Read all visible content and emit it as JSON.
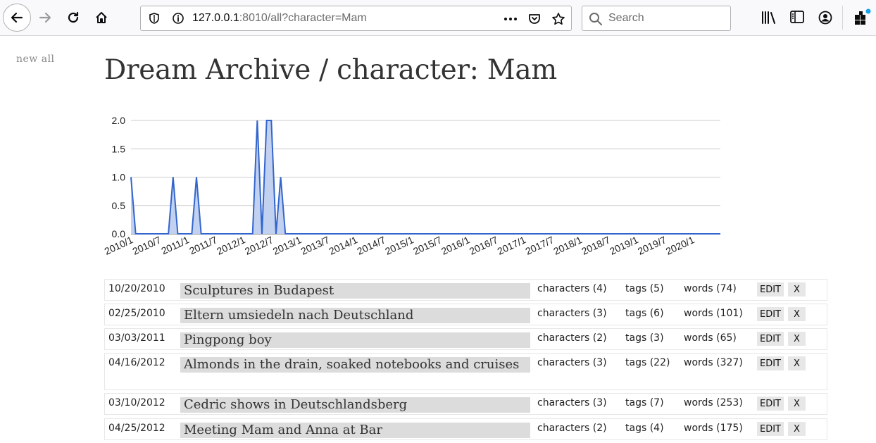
{
  "browser": {
    "url_host": "127.0.0.1",
    "url_rest": ":8010/all?character=Mam",
    "search_placeholder": "Search",
    "icons": [
      "back-arrow-icon",
      "forward-arrow-icon",
      "reload-icon",
      "home-icon",
      "shield-icon",
      "info-icon",
      "more-icon",
      "pocket-icon",
      "star-icon",
      "search-icon",
      "library-icon",
      "sidebar-icon",
      "account-icon",
      "extensions-icon"
    ]
  },
  "nav": {
    "new_all": "new all"
  },
  "page": {
    "title": "Dream Archive / character: Mam"
  },
  "chart_data": {
    "type": "area",
    "x": [
      "2010/1",
      "2010/2",
      "2010/3",
      "2010/4",
      "2010/5",
      "2010/6",
      "2010/7",
      "2010/8",
      "2010/9",
      "2010/10",
      "2010/11",
      "2010/12",
      "2011/1",
      "2011/2",
      "2011/3",
      "2011/4",
      "2011/5",
      "2011/6",
      "2011/7",
      "2011/8",
      "2011/9",
      "2011/10",
      "2011/11",
      "2011/12",
      "2012/1",
      "2012/2",
      "2012/3",
      "2012/4",
      "2012/5",
      "2012/6",
      "2012/7",
      "2012/8",
      "2012/9",
      "2012/10",
      "2012/11",
      "2012/12",
      "2013/1",
      "2013/2",
      "2013/3",
      "2013/4",
      "2013/5",
      "2013/6",
      "2013/7",
      "2013/8",
      "2013/9",
      "2013/10",
      "2013/11",
      "2013/12",
      "2014/1",
      "2014/2",
      "2014/3",
      "2014/4",
      "2014/5",
      "2014/6",
      "2014/7",
      "2014/8",
      "2014/9",
      "2014/10",
      "2014/11",
      "2014/12",
      "2015/1",
      "2015/2",
      "2015/3",
      "2015/4",
      "2015/5",
      "2015/6",
      "2015/7",
      "2015/8",
      "2015/9",
      "2015/10",
      "2015/11",
      "2015/12",
      "2016/1",
      "2016/2",
      "2016/3",
      "2016/4",
      "2016/5",
      "2016/6",
      "2016/7",
      "2016/8",
      "2016/9",
      "2016/10",
      "2016/11",
      "2016/12",
      "2017/1",
      "2017/2",
      "2017/3",
      "2017/4",
      "2017/5",
      "2017/6",
      "2017/7",
      "2017/8",
      "2017/9",
      "2017/10",
      "2017/11",
      "2017/12",
      "2018/1",
      "2018/2",
      "2018/3",
      "2018/4",
      "2018/5",
      "2018/6",
      "2018/7",
      "2018/8",
      "2018/9",
      "2018/10",
      "2018/11",
      "2018/12",
      "2019/1",
      "2019/2",
      "2019/3",
      "2019/4",
      "2019/5",
      "2019/6",
      "2019/7",
      "2019/8",
      "2019/9",
      "2019/10",
      "2019/11",
      "2019/12",
      "2020/1",
      "2020/2",
      "2020/3",
      "2020/4",
      "2020/5",
      "2020/6",
      "2020/7"
    ],
    "values": [
      1,
      0,
      0,
      0,
      0,
      0,
      0,
      0,
      0,
      1,
      0,
      0,
      0,
      0,
      1,
      0,
      0,
      0,
      0,
      0,
      0,
      0,
      0,
      0,
      0,
      0,
      0,
      2,
      0,
      2,
      2,
      0,
      1,
      0,
      0,
      0,
      0,
      0,
      0,
      0,
      0,
      0,
      0,
      0,
      0,
      0,
      0,
      0,
      0,
      0,
      0,
      0,
      0,
      0,
      0,
      0,
      0,
      0,
      0,
      0,
      0,
      0,
      0,
      0,
      0,
      0,
      0,
      0,
      0,
      0,
      0,
      0,
      0,
      0,
      0,
      0,
      0,
      0,
      0,
      0,
      0,
      0,
      0,
      0,
      0,
      0,
      0,
      0,
      0,
      0,
      0,
      0,
      0,
      0,
      0,
      0,
      0,
      0,
      0,
      0,
      0,
      0,
      0,
      0,
      0,
      0,
      0,
      0,
      0,
      0,
      0,
      0,
      0,
      0,
      0,
      0,
      0,
      0,
      0,
      0,
      0,
      0,
      0,
      0,
      0,
      0,
      0
    ],
    "tick_labels": [
      "2010/1",
      "2010/7",
      "2011/1",
      "2011/7",
      "2012/1",
      "2012/7",
      "2013/1",
      "2013/7",
      "2014/1",
      "2014/7",
      "2015/1",
      "2015/7",
      "2016/1",
      "2016/7",
      "2017/1",
      "2017/7",
      "2018/1",
      "2018/7",
      "2019/1",
      "2019/7",
      "2020/1"
    ],
    "y_ticks": [
      "0.0",
      "0.5",
      "1.0",
      "1.5",
      "2.0"
    ],
    "ylim": [
      0,
      2
    ],
    "grid": true,
    "line_color": "#3366cc",
    "fill_color": "#c3d1f0"
  },
  "dreams": [
    {
      "date": "10/20/2010",
      "title": "Sculptures in Budapest",
      "characters": "characters (4)",
      "tags": "tags (5)",
      "words": "words (74)",
      "edit": "EDIT",
      "delete": "X"
    },
    {
      "date": "02/25/2010",
      "title": "Eltern umsiedeln nach Deutschland",
      "characters": "characters (3)",
      "tags": "tags (6)",
      "words": "words (101)",
      "edit": "EDIT",
      "delete": "X"
    },
    {
      "date": "03/03/2011",
      "title": "Pingpong boy",
      "characters": "characters (2)",
      "tags": "tags (3)",
      "words": "words (65)",
      "edit": "EDIT",
      "delete": "X"
    },
    {
      "date": "04/16/2012",
      "title": "Almonds in the drain, soaked notebooks and cruises",
      "characters": "characters (3)",
      "tags": "tags (22)",
      "words": "words (327)",
      "edit": "EDIT",
      "delete": "X"
    },
    {
      "date": "03/10/2012",
      "title": "Cedric shows in Deutschlandsberg",
      "characters": "characters (3)",
      "tags": "tags (7)",
      "words": "words (253)",
      "edit": "EDIT",
      "delete": "X"
    },
    {
      "date": "04/25/2012",
      "title": "Meeting Mam and Anna at Bar",
      "characters": "characters (2)",
      "tags": "tags (4)",
      "words": "words (175)",
      "edit": "EDIT",
      "delete": "X"
    }
  ]
}
